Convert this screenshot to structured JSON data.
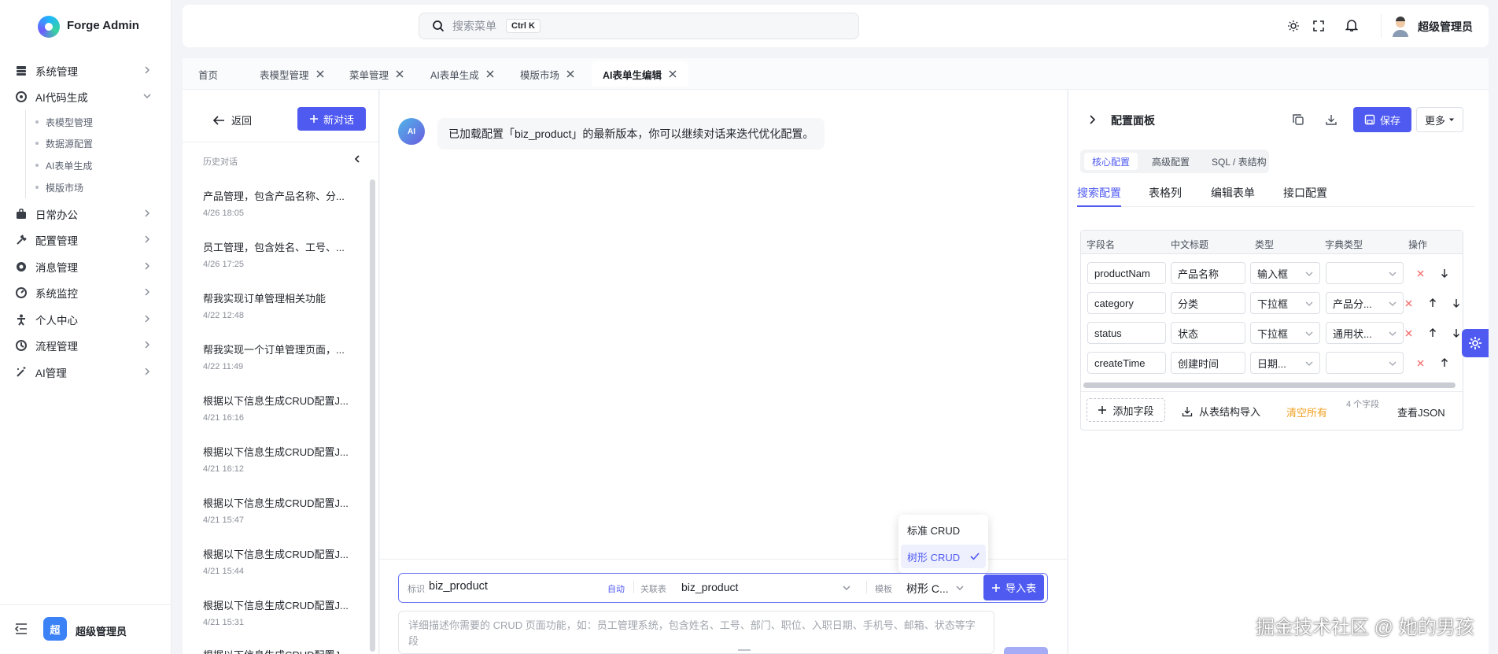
{
  "app": {
    "name": "Forge Admin"
  },
  "sidebar": {
    "menu": [
      {
        "label": "系统管理",
        "icon": "system-icon"
      },
      {
        "label": "AI代码生成",
        "icon": "code-gen-icon"
      },
      {
        "label": "日常办公",
        "icon": "briefcase-icon"
      },
      {
        "label": "配置管理",
        "icon": "tools-icon"
      },
      {
        "label": "消息管理",
        "icon": "message-icon"
      },
      {
        "label": "系统监控",
        "icon": "monitor-icon"
      },
      {
        "label": "个人中心",
        "icon": "person-icon"
      },
      {
        "label": "流程管理",
        "icon": "flow-icon"
      },
      {
        "label": "AI管理",
        "icon": "ai-wand-icon"
      }
    ],
    "sub_menu": [
      "表模型管理",
      "数据源配置",
      "AI表单生成",
      "模版市场"
    ],
    "footer": {
      "badge": "超",
      "user": "超级管理员"
    }
  },
  "header": {
    "search_placeholder": "搜索菜单",
    "shortcut": "Ctrl K",
    "user_name": "超级管理员"
  },
  "tabs": [
    {
      "label": "首页"
    },
    {
      "label": "表模型管理"
    },
    {
      "label": "菜单管理"
    },
    {
      "label": "AI表单生成"
    },
    {
      "label": "模版市场"
    },
    {
      "label": "AI表单生编辑"
    }
  ],
  "history": {
    "back_label": "返回",
    "new_chat_label": "新对话",
    "section_title": "历史对话",
    "items": [
      {
        "title": "产品管理，包含产品名称、分...",
        "time": "4/26 18:05"
      },
      {
        "title": "员工管理，包含姓名、工号、...",
        "time": "4/26 17:25"
      },
      {
        "title": "帮我实现订单管理相关功能",
        "time": "4/22 12:48"
      },
      {
        "title": "帮我实现一个订单管理页面，...",
        "time": "4/22 11:49"
      },
      {
        "title": "根据以下信息生成CRUD配置J...",
        "time": "4/21 16:16"
      },
      {
        "title": "根据以下信息生成CRUD配置J...",
        "time": "4/21 16:12"
      },
      {
        "title": "根据以下信息生成CRUD配置J...",
        "time": "4/21 15:47"
      },
      {
        "title": "根据以下信息生成CRUD配置J...",
        "time": "4/21 15:44"
      },
      {
        "title": "根据以下信息生成CRUD配置J...",
        "time": "4/21 15:31"
      },
      {
        "title": "根据以下信息生成CRUD配置J...",
        "time": ""
      }
    ]
  },
  "chat": {
    "avatar": "AI",
    "message": "已加载配置「biz_product」的最新版本，你可以继续对话来迭代优化配置。",
    "template_options": [
      {
        "label": "标准 CRUD",
        "selected": false
      },
      {
        "label": "树形 CRUD",
        "selected": true
      }
    ],
    "composer": {
      "id_label": "标识",
      "id_value": "biz_product",
      "auto_label": "自动",
      "table_label": "关联表",
      "table_value": "biz_product",
      "template_label": "模板",
      "template_value": "树形 C...",
      "import_label": "导入表",
      "placeholder": "详细描述你需要的 CRUD 页面功能，如：员工管理系统，包含姓名、工号、部门、职位、入职日期、手机号、邮箱、状态等字段"
    }
  },
  "config": {
    "title": "配置面板",
    "save_label": "保存",
    "more_label": "更多",
    "seg_tabs": [
      "核心配置",
      "高级配置",
      "SQL / 表结构"
    ],
    "sub_tabs": [
      "搜索配置",
      "表格列",
      "编辑表单",
      "接口配置"
    ],
    "columns": [
      "字段名",
      "中文标题",
      "类型",
      "字典类型",
      "操作"
    ],
    "rows": [
      {
        "field": "productNam",
        "title": "产品名称",
        "type": "输入框",
        "dict": ""
      },
      {
        "field": "category",
        "title": "分类",
        "type": "下拉框",
        "dict": "产品分..."
      },
      {
        "field": "status",
        "title": "状态",
        "type": "下拉框",
        "dict": "通用状..."
      },
      {
        "field": "createTime",
        "title": "创建时间",
        "type": "日期...",
        "dict": ""
      }
    ],
    "add_field_label": "添加字段",
    "import_from_table_label": "从表结构导入",
    "clear_all_label": "清空所有",
    "field_count_label": "4 个字段",
    "view_json_label": "查看JSON"
  },
  "colors": {
    "primary": "#4f5af0",
    "danger": "#f56c6c",
    "warning": "#f0a020"
  },
  "credit": "掘金技术社区 @ 她的男孩"
}
